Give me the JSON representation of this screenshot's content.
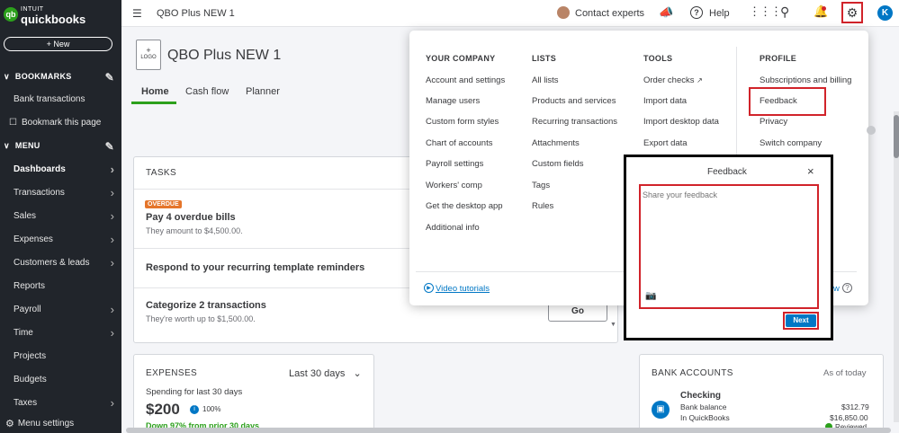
{
  "sidebar": {
    "brand_intuit": "INTUIT",
    "brand_name": "quickbooks",
    "brand_icon": "qb",
    "new_label": "+ New",
    "bookmarks_label": "BOOKMARKS",
    "bookmark_items": [
      "Bank transactions",
      "Bookmark this page"
    ],
    "menu_label": "MENU",
    "menu_items": [
      "Dashboards",
      "Transactions",
      "Sales",
      "Expenses",
      "Customers & leads",
      "Reports",
      "Payroll",
      "Time",
      "Projects",
      "Budgets",
      "Taxes"
    ],
    "menu_settings_label": "Menu settings"
  },
  "topbar": {
    "company_name": "QBO Plus NEW 1",
    "contact_experts": "Contact experts",
    "help": "Help",
    "avatar_initial": "K"
  },
  "header": {
    "logo_plus": "+",
    "logo_text": "LOGO",
    "company_title": "QBO Plus NEW 1",
    "tabs": [
      "Home",
      "Cash flow",
      "Planner"
    ]
  },
  "tasks": {
    "title": "TASKS",
    "overdue_badge": "OVERDUE",
    "task1_title": "Pay 4 overdue bills",
    "task1_sub": "They amount to $4,500.00.",
    "task2_title": "Respond to your recurring template reminders",
    "task3_title": "Categorize 2 transactions",
    "task3_sub": "They're worth up to $1,500.00.",
    "go_label": "Go"
  },
  "expenses": {
    "title": "EXPENSES",
    "period": "Last 30 days",
    "subtitle": "Spending for last 30 days",
    "amount": "$200",
    "pct": "100%",
    "trend": "Down 97% from prior 30 days"
  },
  "bank": {
    "title": "BANK ACCOUNTS",
    "as_of": "As of today",
    "account": "Checking",
    "bank_balance_label": "Bank balance",
    "bank_balance": "$312.79",
    "qb_label": "In QuickBooks",
    "qb_balance": "$16,850.00",
    "reviewed_label": "Reviewed"
  },
  "dropdown": {
    "your_company": {
      "heading": "YOUR COMPANY",
      "items": [
        "Account and settings",
        "Manage users",
        "Custom form styles",
        "Chart of accounts",
        "Payroll settings",
        "Workers' comp",
        "Get the desktop app",
        "Additional info"
      ]
    },
    "lists": {
      "heading": "LISTS",
      "items": [
        "All lists",
        "Products and services",
        "Recurring transactions",
        "Attachments",
        "Custom fields",
        "Tags",
        "Rules"
      ]
    },
    "tools": {
      "heading": "TOOLS",
      "items": [
        "Order checks",
        "Import data",
        "Import desktop data",
        "Export data"
      ]
    },
    "profile": {
      "heading": "PROFILE",
      "items": [
        "Subscriptions and billing",
        "Feedback",
        "Privacy",
        "Switch company"
      ]
    },
    "video_tutorials": "Video tutorials",
    "hidden_link_tail": "w"
  },
  "feedback_modal": {
    "title": "Feedback",
    "close": "×",
    "placeholder": "Share your feedback",
    "next_label": "Next"
  },
  "colors": {
    "sidebar_bg": "#21252b",
    "accent_green": "#2ca01c",
    "link_blue": "#0077c5",
    "highlight_red": "#d1232a",
    "overdue_orange": "#e5752a"
  }
}
